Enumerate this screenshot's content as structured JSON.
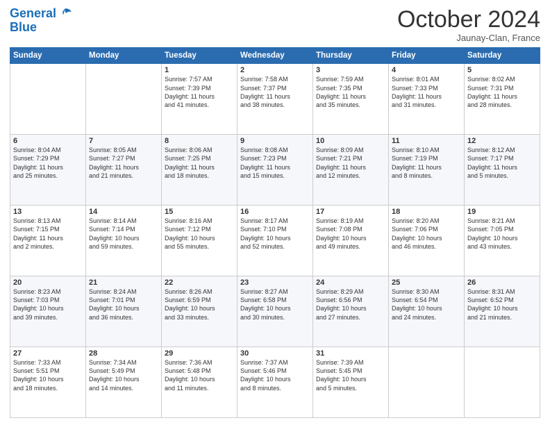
{
  "header": {
    "logo_line1": "General",
    "logo_line2": "Blue",
    "month": "October 2024",
    "location": "Jaunay-Clan, France"
  },
  "weekdays": [
    "Sunday",
    "Monday",
    "Tuesday",
    "Wednesday",
    "Thursday",
    "Friday",
    "Saturday"
  ],
  "weeks": [
    [
      {
        "day": "",
        "info": ""
      },
      {
        "day": "",
        "info": ""
      },
      {
        "day": "1",
        "info": "Sunrise: 7:57 AM\nSunset: 7:39 PM\nDaylight: 11 hours\nand 41 minutes."
      },
      {
        "day": "2",
        "info": "Sunrise: 7:58 AM\nSunset: 7:37 PM\nDaylight: 11 hours\nand 38 minutes."
      },
      {
        "day": "3",
        "info": "Sunrise: 7:59 AM\nSunset: 7:35 PM\nDaylight: 11 hours\nand 35 minutes."
      },
      {
        "day": "4",
        "info": "Sunrise: 8:01 AM\nSunset: 7:33 PM\nDaylight: 11 hours\nand 31 minutes."
      },
      {
        "day": "5",
        "info": "Sunrise: 8:02 AM\nSunset: 7:31 PM\nDaylight: 11 hours\nand 28 minutes."
      }
    ],
    [
      {
        "day": "6",
        "info": "Sunrise: 8:04 AM\nSunset: 7:29 PM\nDaylight: 11 hours\nand 25 minutes."
      },
      {
        "day": "7",
        "info": "Sunrise: 8:05 AM\nSunset: 7:27 PM\nDaylight: 11 hours\nand 21 minutes."
      },
      {
        "day": "8",
        "info": "Sunrise: 8:06 AM\nSunset: 7:25 PM\nDaylight: 11 hours\nand 18 minutes."
      },
      {
        "day": "9",
        "info": "Sunrise: 8:08 AM\nSunset: 7:23 PM\nDaylight: 11 hours\nand 15 minutes."
      },
      {
        "day": "10",
        "info": "Sunrise: 8:09 AM\nSunset: 7:21 PM\nDaylight: 11 hours\nand 12 minutes."
      },
      {
        "day": "11",
        "info": "Sunrise: 8:10 AM\nSunset: 7:19 PM\nDaylight: 11 hours\nand 8 minutes."
      },
      {
        "day": "12",
        "info": "Sunrise: 8:12 AM\nSunset: 7:17 PM\nDaylight: 11 hours\nand 5 minutes."
      }
    ],
    [
      {
        "day": "13",
        "info": "Sunrise: 8:13 AM\nSunset: 7:15 PM\nDaylight: 11 hours\nand 2 minutes."
      },
      {
        "day": "14",
        "info": "Sunrise: 8:14 AM\nSunset: 7:14 PM\nDaylight: 10 hours\nand 59 minutes."
      },
      {
        "day": "15",
        "info": "Sunrise: 8:16 AM\nSunset: 7:12 PM\nDaylight: 10 hours\nand 55 minutes."
      },
      {
        "day": "16",
        "info": "Sunrise: 8:17 AM\nSunset: 7:10 PM\nDaylight: 10 hours\nand 52 minutes."
      },
      {
        "day": "17",
        "info": "Sunrise: 8:19 AM\nSunset: 7:08 PM\nDaylight: 10 hours\nand 49 minutes."
      },
      {
        "day": "18",
        "info": "Sunrise: 8:20 AM\nSunset: 7:06 PM\nDaylight: 10 hours\nand 46 minutes."
      },
      {
        "day": "19",
        "info": "Sunrise: 8:21 AM\nSunset: 7:05 PM\nDaylight: 10 hours\nand 43 minutes."
      }
    ],
    [
      {
        "day": "20",
        "info": "Sunrise: 8:23 AM\nSunset: 7:03 PM\nDaylight: 10 hours\nand 39 minutes."
      },
      {
        "day": "21",
        "info": "Sunrise: 8:24 AM\nSunset: 7:01 PM\nDaylight: 10 hours\nand 36 minutes."
      },
      {
        "day": "22",
        "info": "Sunrise: 8:26 AM\nSunset: 6:59 PM\nDaylight: 10 hours\nand 33 minutes."
      },
      {
        "day": "23",
        "info": "Sunrise: 8:27 AM\nSunset: 6:58 PM\nDaylight: 10 hours\nand 30 minutes."
      },
      {
        "day": "24",
        "info": "Sunrise: 8:29 AM\nSunset: 6:56 PM\nDaylight: 10 hours\nand 27 minutes."
      },
      {
        "day": "25",
        "info": "Sunrise: 8:30 AM\nSunset: 6:54 PM\nDaylight: 10 hours\nand 24 minutes."
      },
      {
        "day": "26",
        "info": "Sunrise: 8:31 AM\nSunset: 6:52 PM\nDaylight: 10 hours\nand 21 minutes."
      }
    ],
    [
      {
        "day": "27",
        "info": "Sunrise: 7:33 AM\nSunset: 5:51 PM\nDaylight: 10 hours\nand 18 minutes."
      },
      {
        "day": "28",
        "info": "Sunrise: 7:34 AM\nSunset: 5:49 PM\nDaylight: 10 hours\nand 14 minutes."
      },
      {
        "day": "29",
        "info": "Sunrise: 7:36 AM\nSunset: 5:48 PM\nDaylight: 10 hours\nand 11 minutes."
      },
      {
        "day": "30",
        "info": "Sunrise: 7:37 AM\nSunset: 5:46 PM\nDaylight: 10 hours\nand 8 minutes."
      },
      {
        "day": "31",
        "info": "Sunrise: 7:39 AM\nSunset: 5:45 PM\nDaylight: 10 hours\nand 5 minutes."
      },
      {
        "day": "",
        "info": ""
      },
      {
        "day": "",
        "info": ""
      }
    ]
  ]
}
